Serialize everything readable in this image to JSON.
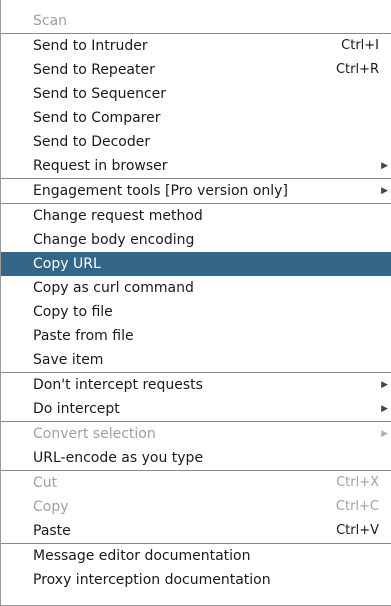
{
  "menu": {
    "scan": {
      "label": "Scan"
    },
    "send_intruder": {
      "label": "Send to Intruder",
      "shortcut": "Ctrl+I"
    },
    "send_repeater": {
      "label": "Send to Repeater",
      "shortcut": "Ctrl+R"
    },
    "send_sequencer": {
      "label": "Send to Sequencer"
    },
    "send_comparer": {
      "label": "Send to Comparer"
    },
    "send_decoder": {
      "label": "Send to Decoder"
    },
    "request_browser": {
      "label": "Request in browser",
      "arrow": "▶"
    },
    "engagement_tools": {
      "label": "Engagement tools [Pro version only]",
      "arrow": "▶"
    },
    "change_method": {
      "label": "Change request method"
    },
    "change_encoding": {
      "label": "Change body encoding"
    },
    "copy_url": {
      "label": "Copy URL"
    },
    "copy_curl": {
      "label": "Copy as curl command"
    },
    "copy_file": {
      "label": "Copy to file"
    },
    "paste_file": {
      "label": "Paste from file"
    },
    "save_item": {
      "label": "Save item"
    },
    "dont_intercept": {
      "label": "Don't intercept requests",
      "arrow": "▶"
    },
    "do_intercept": {
      "label": "Do intercept",
      "arrow": "▶"
    },
    "convert_selection": {
      "label": "Convert selection",
      "arrow": "▶"
    },
    "url_encode": {
      "label": "URL-encode as you type"
    },
    "cut": {
      "label": "Cut",
      "shortcut": "Ctrl+X"
    },
    "copy": {
      "label": "Copy",
      "shortcut": "Ctrl+C"
    },
    "paste": {
      "label": "Paste",
      "shortcut": "Ctrl+V"
    },
    "editor_docs": {
      "label": "Message editor documentation"
    },
    "proxy_docs": {
      "label": "Proxy interception documentation"
    }
  },
  "colors": {
    "highlight_bg": "#336688",
    "highlight_text": "#ffffff",
    "disabled_text": "#a0a0a0",
    "separator": "#8a8a8a"
  }
}
